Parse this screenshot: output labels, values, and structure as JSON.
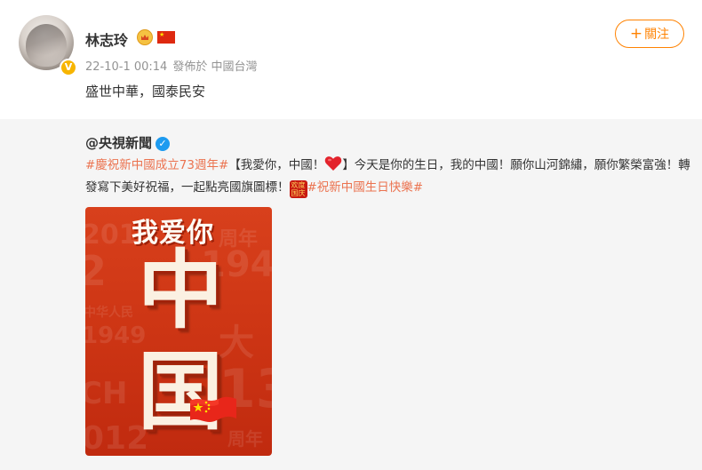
{
  "post": {
    "username": "林志玲",
    "timestamp": "22-10-1 00:14",
    "source": "發佈於 中國台灣",
    "text": "盛世中華，國泰民安",
    "follow_label": "關注",
    "icons": {
      "avatar": "avatar-photo",
      "verified": "yellow-verified-badge",
      "crown": "crown-icon",
      "flag": "china-flag-icon",
      "plus": "plus-icon"
    }
  },
  "repost": {
    "author": "@央視新聞",
    "tag1": "#慶祝新中國成立73週年#",
    "text_part1": "【我愛你，中國！",
    "text_part2": "】今天是你的生日，我的中國！願你山河錦繡，願你繁榮富強！轉發寫下美好祝福，一起點亮國旗圖標！",
    "tag2": "#祝新中國生日快樂#",
    "festival_icon_text": "欢度国庆",
    "poster": {
      "title": "我爱你",
      "char1": "中",
      "char2": "国"
    }
  },
  "colors": {
    "accent": "#ff8200",
    "tag": "#eb7350",
    "poster_red": "#d23a16",
    "verified_blue": "#1d9bf0"
  }
}
